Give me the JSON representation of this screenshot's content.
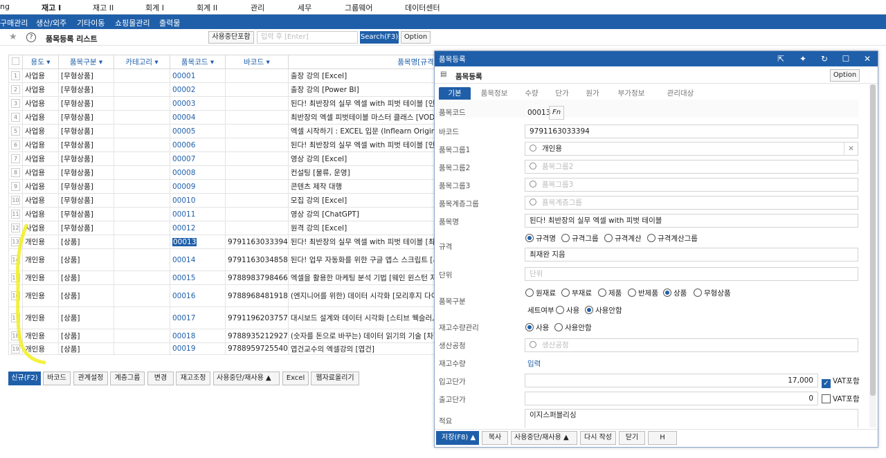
{
  "topmenu": {
    "items": [
      "ng",
      "재고 I",
      "재고 II",
      "회계 I",
      "회계 II",
      "관리",
      "세무",
      "그룹웨어",
      "데이터센터"
    ],
    "active_index": 1
  },
  "submenu": {
    "items": [
      "구매관리",
      "생산/외주",
      "기타이동",
      "쇼핑몰관리",
      "출력물"
    ]
  },
  "list": {
    "title": "품목등록 리스트",
    "include_stopped_label": "사용중단포함",
    "search_placeholder": "입력 후 [Enter]",
    "search_button": "Search(F3)",
    "option_button": "Option",
    "columns": [
      "용도",
      "품목구분",
      "카테고리",
      "품목코드",
      "바코드",
      "품목명[규격]"
    ],
    "rows": [
      {
        "no": "1",
        "use": "사업용",
        "type": "[무형상품]",
        "cat": "",
        "code": "00001",
        "barcode": "",
        "name": "출장 강의 [Excel]"
      },
      {
        "no": "2",
        "use": "사업용",
        "type": "[무형상품]",
        "cat": "",
        "code": "00002",
        "barcode": "",
        "name": "출장 강의 [Power BI]"
      },
      {
        "no": "3",
        "use": "사업용",
        "type": "[무형상품]",
        "cat": "",
        "code": "00003",
        "barcode": "",
        "name": "된다! 최반장의 실무 엑셀 with 피벗 테이블 [인세-종"
      },
      {
        "no": "4",
        "use": "사업용",
        "type": "[무형상품]",
        "cat": "",
        "code": "00004",
        "barcode": "",
        "name": "최반장의 엑셀 피벗테이블 마스터 클래스 [VOD]"
      },
      {
        "no": "5",
        "use": "사업용",
        "type": "[무형상품]",
        "cat": "",
        "code": "00005",
        "barcode": "",
        "name": "엑셀 시작하기 : EXCEL 입문 (Inflearn Original) [VOD"
      },
      {
        "no": "6",
        "use": "사업용",
        "type": "[무형상품]",
        "cat": "",
        "code": "00006",
        "barcode": "",
        "name": "된다! 최반장의 실무 엑셀 with 피벗 테이블 [인세-전"
      },
      {
        "no": "7",
        "use": "사업용",
        "type": "[무형상품]",
        "cat": "",
        "code": "00007",
        "barcode": "",
        "name": "영상 강의 [Excel]"
      },
      {
        "no": "8",
        "use": "사업용",
        "type": "[무형상품]",
        "cat": "",
        "code": "00008",
        "barcode": "",
        "name": "컨설팅 [물류, 운영]"
      },
      {
        "no": "9",
        "use": "사업용",
        "type": "[무형상품]",
        "cat": "",
        "code": "00009",
        "barcode": "",
        "name": "콘텐츠 제작 대행"
      },
      {
        "no": "10",
        "use": "사업용",
        "type": "[무형상품]",
        "cat": "",
        "code": "00010",
        "barcode": "",
        "name": "모집 강의 [Excel]"
      },
      {
        "no": "11",
        "use": "사업용",
        "type": "[무형상품]",
        "cat": "",
        "code": "00011",
        "barcode": "",
        "name": "영상 강의 [ChatGPT]"
      },
      {
        "no": "12",
        "use": "사업용",
        "type": "[무형상품]",
        "cat": "",
        "code": "00012",
        "barcode": "",
        "name": "원격 강의 [Excel]"
      },
      {
        "no": "13",
        "use": "개인용",
        "type": "[상품]",
        "cat": "",
        "code": "00013",
        "barcode": "9791163033394",
        "name": "된다! 최반장의 실무 엑셀 with 피벗 테이블 [최재완"
      },
      {
        "no": "14",
        "use": "개인용",
        "type": "[상품]",
        "cat": "",
        "code": "00014",
        "barcode": "9791163034858",
        "name": "된다! 업무 자동화를 위한 구글 앱스 스크립트 [사카이 시 지음 ;안동현 옮김]"
      },
      {
        "no": "15",
        "use": "개인용",
        "type": "[상품]",
        "cat": "",
        "code": "00015",
        "barcode": "9788983798466",
        "name": "엑셀을 활용한 마케팅 분석 기법 [웨인 윈스턴 저 ; 김"
      },
      {
        "no": "16",
        "use": "개인용",
        "type": "[상품]",
        "cat": "",
        "code": "00016",
        "barcode": "9788968481918",
        "name": "(엔지니어를 위한) 데이터 시각화 [모리후지 다이지,오 안 지음 ;김성재 옮김]"
      },
      {
        "no": "17",
        "use": "개인용",
        "type": "[상품]",
        "cat": "",
        "code": "00017",
        "barcode": "9791196203757",
        "name": "대시보드 설계와 데이터 시각화 [스티브 웩슬러,제프 디 코트그리브 지음 ;최윤석 옮김]"
      },
      {
        "no": "18",
        "use": "개인용",
        "type": "[상품]",
        "cat": "",
        "code": "00018",
        "barcode": "9788935212927",
        "name": "(숫자를 돈으로 바꾸는) 데이터 읽기의 기술 [차현나"
      },
      {
        "no": "19",
        "use": "개인용",
        "type": "[상품]",
        "cat": "",
        "code": "00019",
        "barcode": "9788959725540",
        "name": "엽건교수의 엑셀강의 [엽건]"
      }
    ],
    "selected_code": "00013",
    "bottom_buttons": [
      "신규(F2)",
      "바코드",
      "관계설정",
      "계층그룹",
      "변경",
      "재고조정",
      "사용중단/재사용",
      "Excel",
      "웹자료올리기"
    ]
  },
  "dialog": {
    "title": "품목등록",
    "subtitle": "품목등록",
    "option_button": "Option",
    "tabs": [
      "기본",
      "품목정보",
      "수량",
      "단가",
      "원가",
      "부가정보",
      "관리대상"
    ],
    "fields": {
      "item_code_label": "품목코드",
      "item_code": "00013",
      "fn_button": "Fn",
      "barcode_label": "바코드",
      "barcode": "9791163033394",
      "group1_label": "품목그룹1",
      "group1": "개인용",
      "group2_label": "품목그룹2",
      "group2_placeholder": "품목그룹2",
      "group3_label": "품목그룹3",
      "group3_placeholder": "품목그룹3",
      "tier_group_label": "품목계층그룹",
      "tier_group_placeholder": "품목계층그룹",
      "name_label": "품목명",
      "name": "된다! 최반장의 실무 엑셀 with 피벗 테이블",
      "spec_label": "규격",
      "spec_options": [
        "규격명",
        "규격그룹",
        "규격계산",
        "규격계산그룹"
      ],
      "spec_selected": 0,
      "spec_value": "최재완 지음",
      "unit_label": "단위",
      "unit_placeholder": "단위",
      "kind_label": "품목구분",
      "kind_options": [
        "원재료",
        "부재료",
        "제품",
        "반제품",
        "상품",
        "무형상품"
      ],
      "kind_selected": 4,
      "set_label": "세트여부",
      "set_options": [
        "사용",
        "사용안함"
      ],
      "set_selected": 1,
      "stock_mgmt_label": "재고수량관리",
      "stock_mgmt_options": [
        "사용",
        "사용안함"
      ],
      "stock_mgmt_selected": 0,
      "process_label": "생산공정",
      "process_placeholder": "생산공정",
      "stock_qty_label": "재고수량",
      "stock_qty_link": "입력",
      "in_price_label": "입고단가",
      "in_price": "17,000",
      "in_vat_label": "VAT포함",
      "in_vat_checked": true,
      "out_price_label": "출고단가",
      "out_price": "0",
      "out_vat_label": "VAT포함",
      "out_vat_checked": false,
      "memo_label": "적요",
      "memo": "이지스퍼블리싱"
    },
    "footer_buttons": [
      "저장(F8)",
      "복사",
      "사용중단/재사용",
      "다시 작성",
      "닫기",
      "H"
    ]
  },
  "colors": {
    "brand": "#1f5fa9",
    "annotation": "#f2ef2a"
  }
}
